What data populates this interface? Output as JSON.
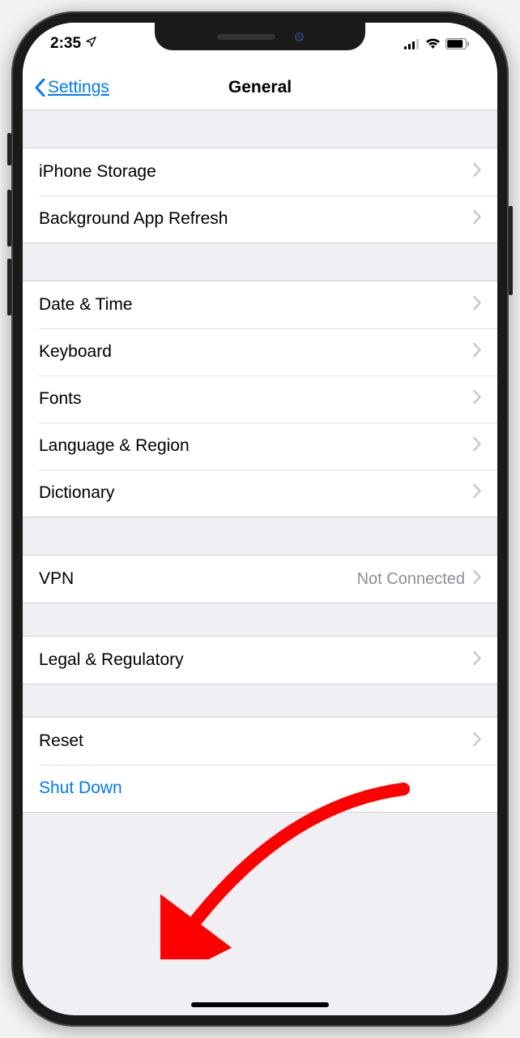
{
  "status": {
    "time": "2:35",
    "location_icon": "location-arrow",
    "signal": "signal-3",
    "wifi": "wifi-3",
    "battery": "battery-high"
  },
  "nav": {
    "back_label": "Settings",
    "title": "General"
  },
  "groups": [
    {
      "rows": [
        {
          "label": "iPhone Storage"
        },
        {
          "label": "Background App Refresh"
        }
      ]
    },
    {
      "rows": [
        {
          "label": "Date & Time"
        },
        {
          "label": "Keyboard"
        },
        {
          "label": "Fonts"
        },
        {
          "label": "Language & Region"
        },
        {
          "label": "Dictionary"
        }
      ]
    },
    {
      "rows": [
        {
          "label": "VPN",
          "detail": "Not Connected"
        }
      ]
    },
    {
      "rows": [
        {
          "label": "Legal & Regulatory"
        }
      ]
    },
    {
      "rows": [
        {
          "label": "Reset"
        },
        {
          "label": "Shut Down",
          "link": true,
          "no_chevron": true
        }
      ]
    }
  ],
  "annotation": {
    "color": "#ff0000",
    "target": "shut-down-row"
  }
}
